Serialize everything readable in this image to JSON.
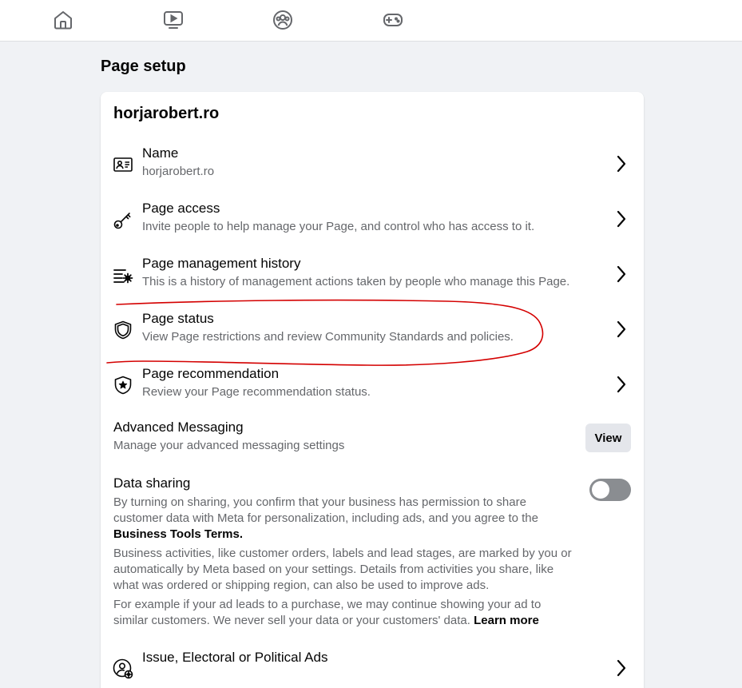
{
  "nav": {
    "icons": [
      "home-icon",
      "video-icon",
      "groups-icon",
      "gaming-icon"
    ]
  },
  "page_title": "Page setup",
  "card": {
    "title": "horjarobert.ro",
    "rows": [
      {
        "title": "Name",
        "subtitle": "horjarobert.ro",
        "icon": "id-card-icon"
      },
      {
        "title": "Page access",
        "subtitle": "Invite people to help manage your Page, and control who has access to it.",
        "icon": "key-icon"
      },
      {
        "title": "Page management history",
        "subtitle": "This is a history of management actions taken by people who manage this Page.",
        "icon": "history-settings-icon"
      },
      {
        "title": "Page status",
        "subtitle": "View Page restrictions and review Community Standards and policies.",
        "icon": "shield-icon"
      },
      {
        "title": "Page recommendation",
        "subtitle": "Review your Page recommendation status.",
        "icon": "shield-star-icon"
      }
    ],
    "advanced": {
      "title": "Advanced Messaging",
      "subtitle": "Manage your advanced messaging settings",
      "button": "View"
    },
    "data_sharing": {
      "title": "Data sharing",
      "p1": "By turning on sharing, you confirm that your business has permission to share customer data with Meta for personalization, including ads, and you agree to the",
      "p1_link": "Business Tools Terms.",
      "p2": "Business activities, like customer orders, labels and lead stages, are marked by you or automatically by Meta based on your settings. Details from activities you share, like what was ordered or shipping region, can also be used to improve ads.",
      "p3": "For example if your ad leads to a purchase, we may continue showing your ad to similar customers. We never sell your data or your customers' data.",
      "p3_link": "Learn more",
      "toggle_on": false
    },
    "political": {
      "title": "Issue, Electoral or Political Ads",
      "icon": "person-settings-icon"
    }
  },
  "colors": {
    "background": "#f0f2f5",
    "card": "#ffffff",
    "secondary_text": "#65676b",
    "annotation": "#d40000"
  }
}
